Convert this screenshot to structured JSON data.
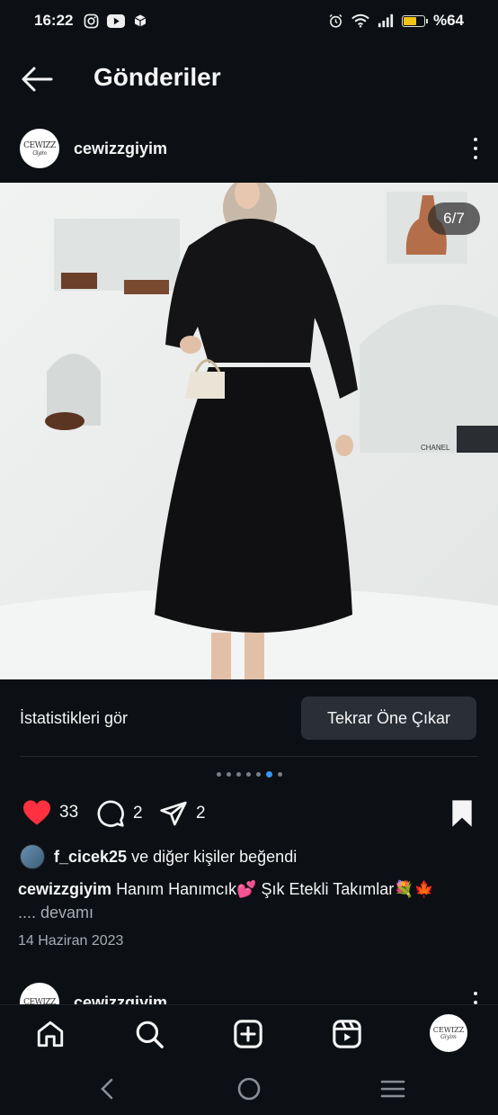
{
  "status_bar": {
    "time": "16:22",
    "battery_text": "%64",
    "battery_level": 0.64,
    "icons": [
      "instagram-icon",
      "youtube-icon",
      "package-icon",
      "alarm-icon",
      "wifi-icon",
      "signal-icon",
      "battery-icon"
    ]
  },
  "header": {
    "title": "Gönderiler"
  },
  "post": {
    "username": "cewizzgiyim",
    "avatar_text": "CEWIZZ",
    "avatar_sub": "Giyim",
    "image_counter": "6/7",
    "current_slide": 6,
    "total_slides": 7,
    "stats_link": "İstatistikleri gör",
    "boost_button": "Tekrar Öne Çıkar",
    "likes_count": "33",
    "comments_count": "2",
    "shares_count": "2",
    "liked_by_user": "f_cicek25",
    "liked_by_suffix": "ve diğer kişiler beğendi",
    "caption_user": "cewizzgiyim",
    "caption_text": "Hanım Hanımcık💕 Şık Etekli Takımlar💐🍁",
    "caption_more": ".... devamı",
    "date": "14 Haziran 2023"
  },
  "next_post": {
    "username": "cewizzgiyim"
  },
  "colors": {
    "background": "#0c1014",
    "like_red": "#ff3040",
    "active_dot": "#3897f0",
    "button_bg": "#2a2f36"
  }
}
